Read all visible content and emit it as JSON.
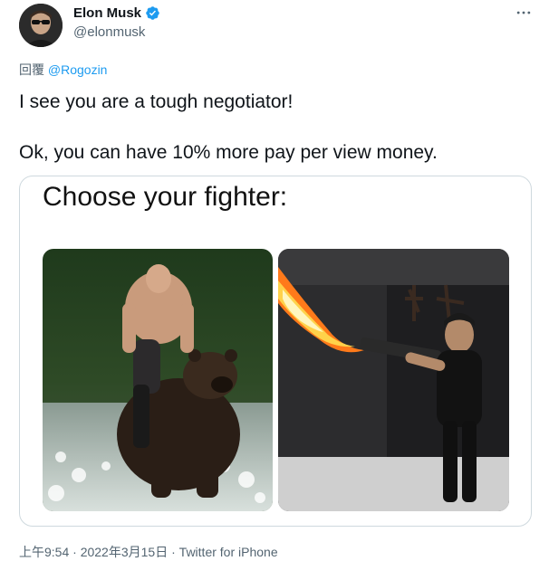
{
  "author": {
    "display_name": "Elon Musk",
    "handle": "@elonmusk",
    "verified": true,
    "avatar_icon": "avatar-photo"
  },
  "more_menu_icon": "more-horizontal-icon",
  "reply": {
    "prefix": "回覆",
    "mention": "@Rogozin"
  },
  "text": {
    "line1": "I see you are a tough negotiator!",
    "line2": "Ok, you can have 10% more pay per view money."
  },
  "media": {
    "caption": "Choose your fighter:",
    "left_image": "shirtless-man-riding-bear-photo",
    "right_image": "man-with-flamethrower-photo"
  },
  "meta": {
    "time": "上午9:54",
    "separator1": " · ",
    "date": "2022年3月15日",
    "separator2": " · ",
    "source": "Twitter for iPhone"
  },
  "colors": {
    "link": "#1d9bf0",
    "secondary_text": "#536471",
    "primary_text": "#0f1419",
    "border": "#cfd9de"
  }
}
